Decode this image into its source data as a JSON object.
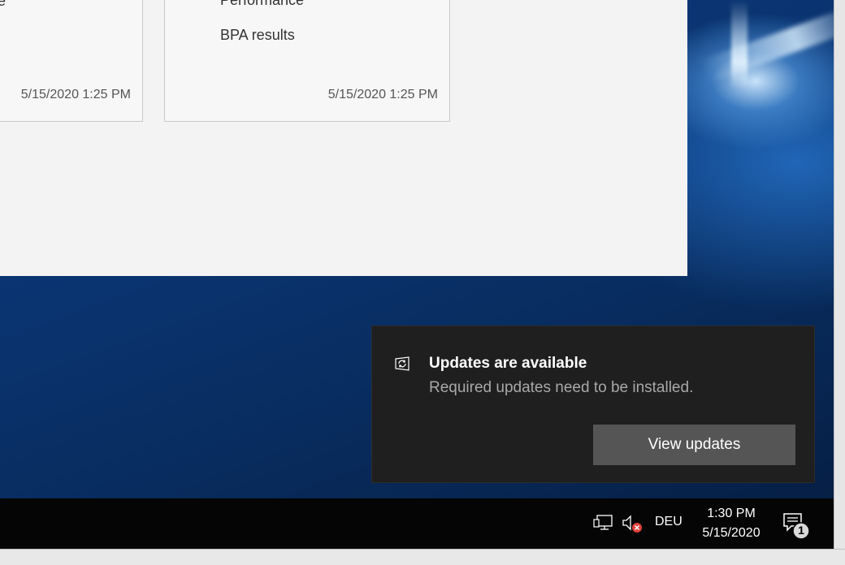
{
  "server_manager": {
    "tile_left": {
      "partial_text": "e",
      "timestamp": "5/15/2020 1:25 PM"
    },
    "tile_right": {
      "line_1": "Performance",
      "line_2": "BPA results",
      "timestamp": "5/15/2020 1:25 PM"
    }
  },
  "toast": {
    "icon": "update-sync-icon",
    "title": "Updates are available",
    "body": "Required updates need to be installed.",
    "button_label": "View updates"
  },
  "taskbar": {
    "tray": {
      "network_icon": "network-icon",
      "volume_icon": "volume-muted-icon",
      "language": "DEU",
      "time": "1:30 PM",
      "date": "5/15/2020",
      "notification_icon": "action-center-icon",
      "notification_count": "1"
    }
  },
  "colors": {
    "toast_bg": "#1f1f1f",
    "toast_button": "#555555",
    "taskbar_bg": "#050505",
    "mute_badge": "#e0403a"
  }
}
